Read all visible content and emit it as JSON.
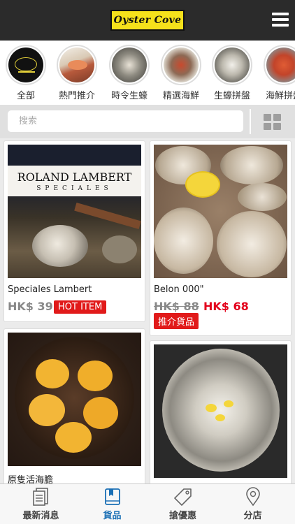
{
  "header": {
    "logo_text": "Oyster Cove",
    "menu_icon": "hamburger-icon"
  },
  "categories": [
    {
      "label": "全部"
    },
    {
      "label": "熱門推介"
    },
    {
      "label": "時令生蠔"
    },
    {
      "label": "精選海鮮"
    },
    {
      "label": "生蠔拼盤"
    },
    {
      "label": "海鮮拼盤"
    }
  ],
  "search": {
    "placeholder": "搜索",
    "view_icon": "grid-view-icon"
  },
  "products": [
    {
      "name": "Speciales Lambert",
      "price": "HK$ 39",
      "badge": "HOT ITEM",
      "image_text_1": "ROLAND LAMBERT",
      "image_text_2": "SPECIALES"
    },
    {
      "name": "Belon 000\"",
      "old_price": "HK$ 88",
      "price": "HK$ 68",
      "badge": "推介貨品"
    },
    {
      "name": "原隻活海膽"
    },
    {
      "name": ""
    }
  ],
  "bottom_nav": [
    {
      "label": "最新消息",
      "icon": "news-icon"
    },
    {
      "label": "貨品",
      "icon": "book-icon",
      "active": true
    },
    {
      "label": "搶優惠",
      "icon": "tag-icon"
    },
    {
      "label": "分店",
      "icon": "location-pin-icon"
    }
  ],
  "colors": {
    "header_bg": "#2b2b2b",
    "logo_bg": "#f5e11b",
    "badge_red": "#e11a1a",
    "sale_red": "#e3001b",
    "active_blue": "#1a6fb5"
  }
}
